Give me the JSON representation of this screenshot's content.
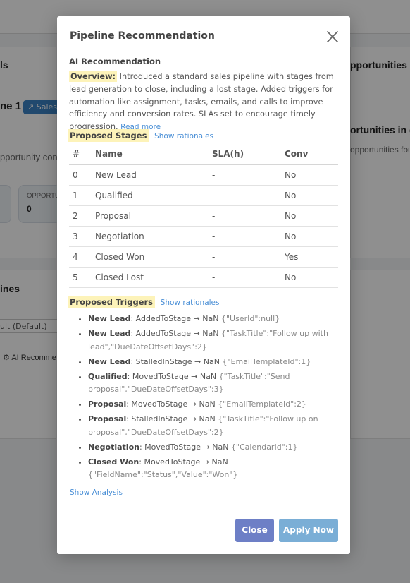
{
  "background": {
    "left_heading": "ls",
    "right_heading": "pportunities i",
    "pipeline_label": "ne 1",
    "sales_badge": "Sales",
    "opp_label": "pportunity con",
    "stat_label": "OPPORTU",
    "stat_value": "0",
    "right_heading_2": "ortunities in g",
    "right_sub": "opportunities foun",
    "lines_heading": "ines",
    "select_value": "ult (Default)",
    "ai_recommend": "AI Recomme"
  },
  "modal": {
    "title": "Pipeline Recommendation",
    "ai_label": "AI Recommendation",
    "overview_label": "Overview:",
    "overview_text": "Introduced a standard sales pipeline with stages from lead generation to close, including a lost stage. Added triggers for automation like assignment, tasks, emails, and calls to improve efficiency and conversion rates. SLAs set to encourage timely progression.",
    "read_more": "Read more",
    "stages_label": "Proposed Stages",
    "show_rationales": "Show rationales",
    "table_headers": [
      "#",
      "Name",
      "SLA(h)",
      "Conv"
    ],
    "stages": [
      {
        "num": "0",
        "name": "New Lead",
        "sla": "-",
        "conv": "No"
      },
      {
        "num": "1",
        "name": "Qualified",
        "sla": "-",
        "conv": "No"
      },
      {
        "num": "2",
        "name": "Proposal",
        "sla": "-",
        "conv": "No"
      },
      {
        "num": "3",
        "name": "Negotiation",
        "sla": "-",
        "conv": "No"
      },
      {
        "num": "4",
        "name": "Closed Won",
        "sla": "-",
        "conv": "Yes"
      },
      {
        "num": "5",
        "name": "Closed Lost",
        "sla": "-",
        "conv": "No"
      }
    ],
    "triggers_label": "Proposed Triggers",
    "show_rationales_2": "Show rationales",
    "triggers": [
      {
        "stage": "New Lead",
        "event": "AddedToStage → NaN",
        "config": "{\"UserId\":null}"
      },
      {
        "stage": "New Lead",
        "event": "AddedToStage → NaN",
        "config": "{\"TaskTitle\":\"Follow up with lead\",\"DueDateOffsetDays\":2}"
      },
      {
        "stage": "New Lead",
        "event": "StalledInStage → NaN",
        "config": "{\"EmailTemplateId\":1}"
      },
      {
        "stage": "Qualified",
        "event": "MovedToStage → NaN",
        "config": "{\"TaskTitle\":\"Send proposal\",\"DueDateOffsetDays\":3}"
      },
      {
        "stage": "Proposal",
        "event": "MovedToStage → NaN",
        "config": "{\"EmailTemplateId\":2}"
      },
      {
        "stage": "Proposal",
        "event": "StalledInStage → NaN",
        "config": "{\"TaskTitle\":\"Follow up on proposal\",\"DueDateOffsetDays\":2}"
      },
      {
        "stage": "Negotiation",
        "event": "MovedToStage → NaN",
        "config": "{\"CalendarId\":1}"
      },
      {
        "stage": "Closed Won",
        "event": "MovedToStage → NaN",
        "config": "{\"FieldName\":\"Status\",\"Value\":\"Won\"}"
      }
    ],
    "show_analysis": "Show Analysis",
    "close_label": "Close",
    "apply_label": "Apply Now"
  },
  "colors": {
    "highlight": "#fdf3b9",
    "link": "#4a8fd6",
    "close_button": "#6d7fc6",
    "apply_button": "#7aaed6"
  },
  "icons": [
    "close-icon",
    "trend-icon",
    "gear-icon"
  ]
}
